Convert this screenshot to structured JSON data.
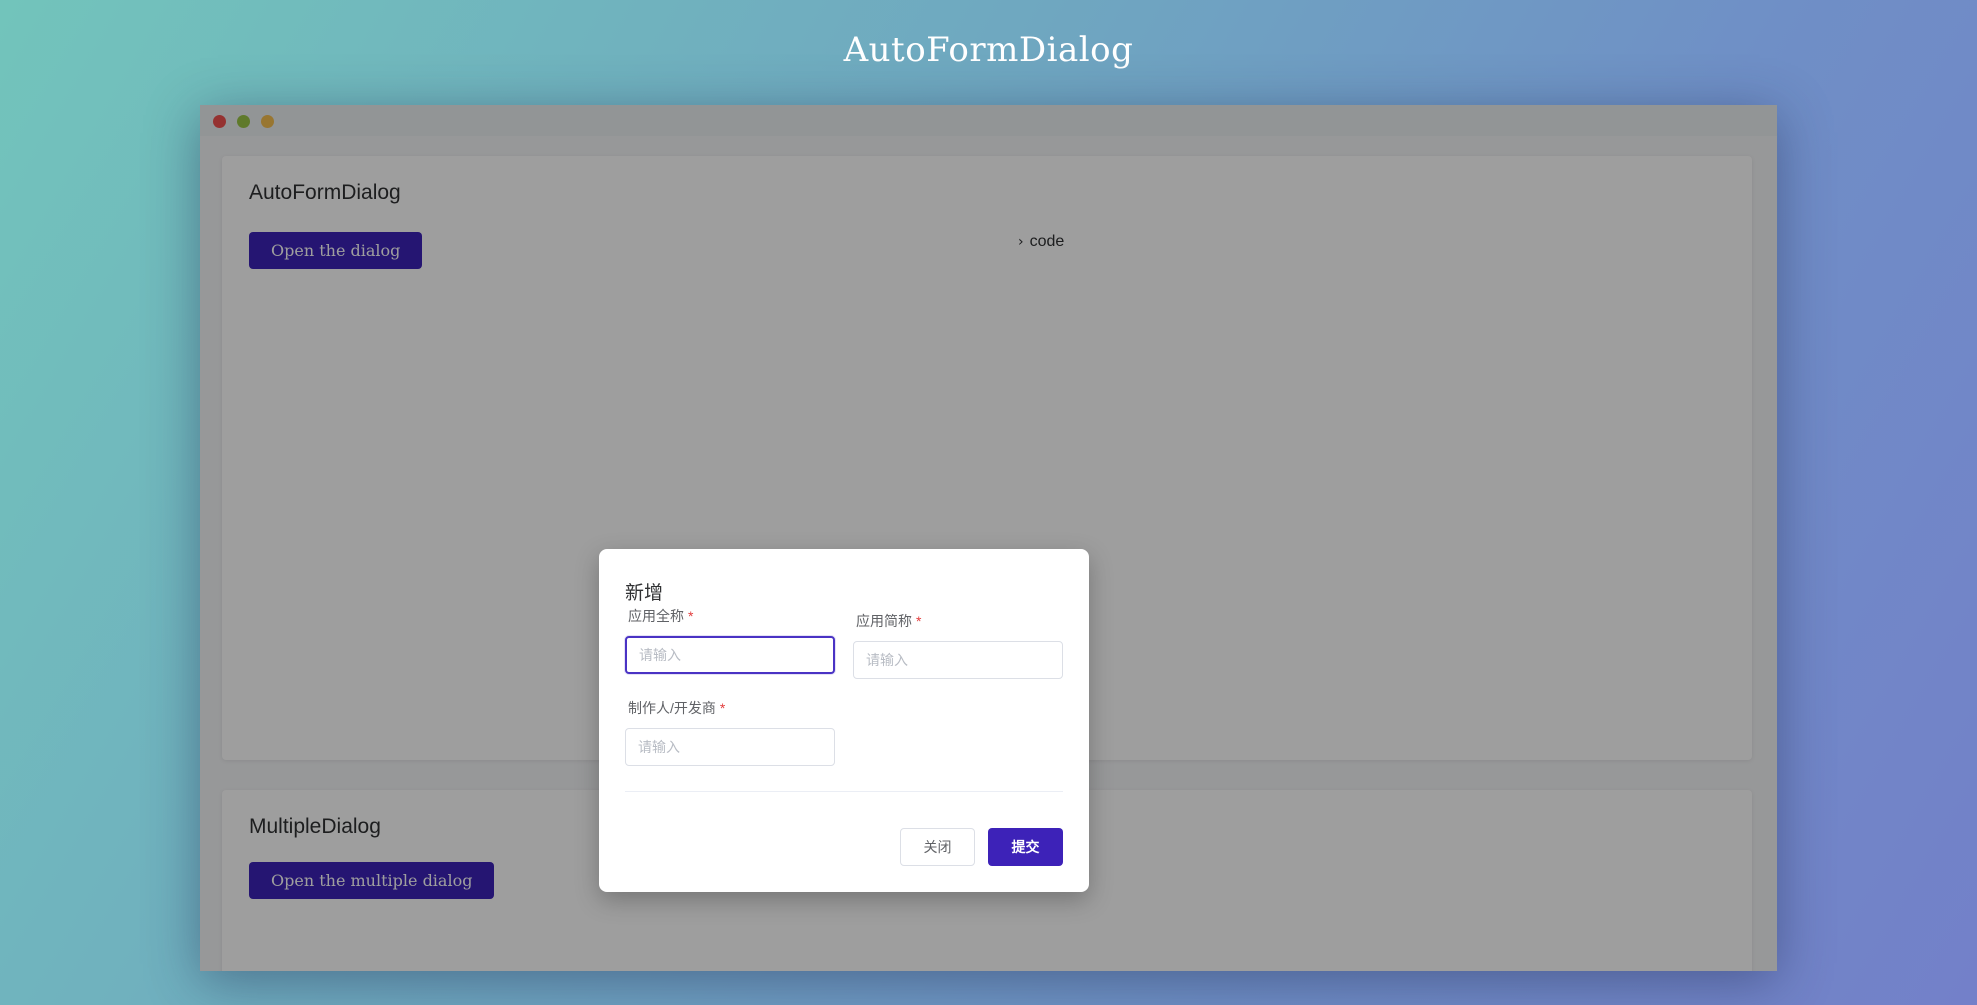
{
  "page": {
    "title": "AutoFormDialog"
  },
  "window": {
    "controls": [
      "close",
      "maximize",
      "minimize"
    ]
  },
  "cards": [
    {
      "title": "AutoFormDialog",
      "button_label": "Open the dialog",
      "code_toggle_label": "code"
    },
    {
      "title": "MultipleDialog",
      "button_label": "Open the multiple dialog"
    }
  ],
  "dialog": {
    "title": "新增",
    "fields": [
      {
        "label": "应用全称",
        "required_mark": "*",
        "placeholder": "请输入",
        "value": ""
      },
      {
        "label": "应用简称",
        "required_mark": "*",
        "placeholder": "请输入",
        "value": ""
      },
      {
        "label": "制作人/开发商",
        "required_mark": "*",
        "placeholder": "请输入",
        "value": ""
      }
    ],
    "cancel_label": "关闭",
    "submit_label": "提交"
  },
  "colors": {
    "primary": "#3d22b8",
    "required": "#e23c3c",
    "close_dot": "#f0524f",
    "maximize_dot": "#9ac646",
    "minimize_dot": "#f5be4f"
  },
  "icons": {
    "code_toggle": "chevron-right-icon"
  }
}
